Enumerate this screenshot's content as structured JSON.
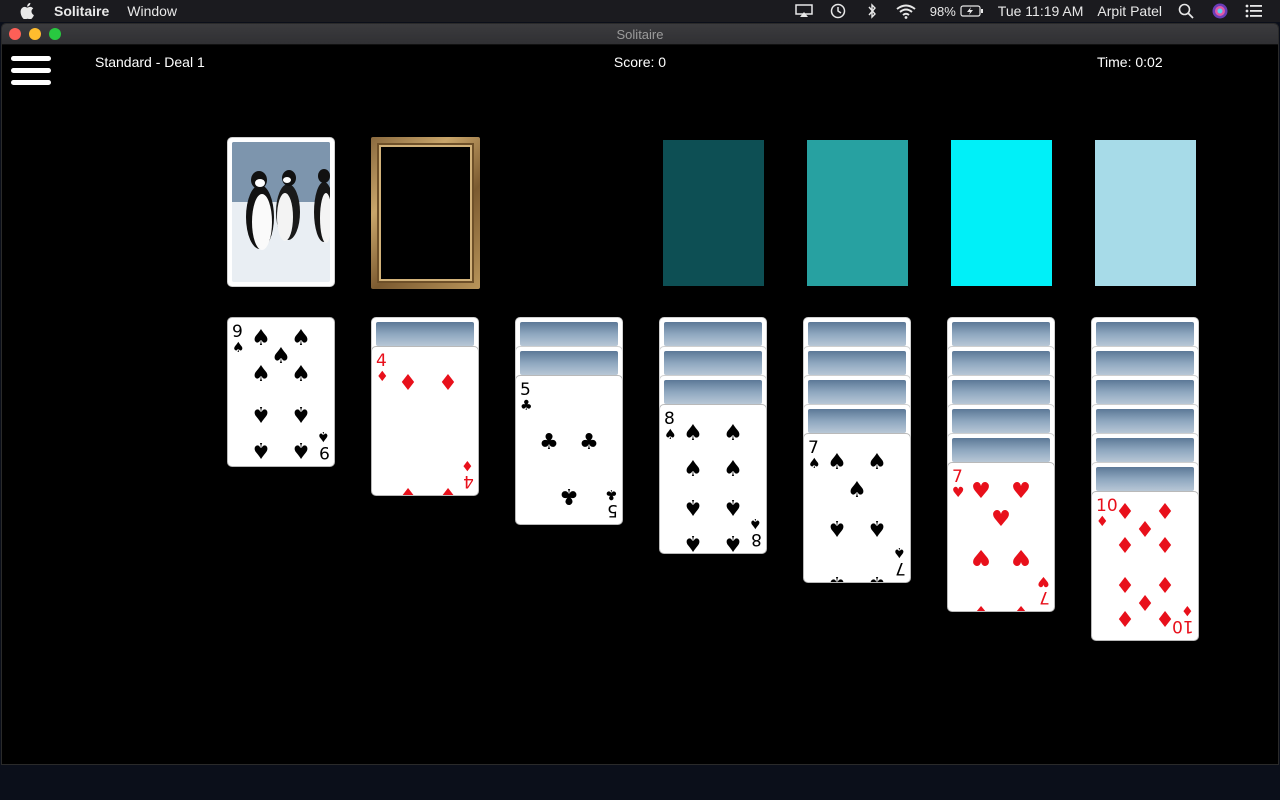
{
  "menubar": {
    "app_name": "Solitaire",
    "menu_window": "Window",
    "battery": "98%",
    "datetime": "Tue 11:19 AM",
    "user": "Arpit Patel",
    "icons": [
      "airplay-icon",
      "time-machine-icon",
      "bluetooth-icon",
      "wifi-icon",
      "battery-icon",
      "spotlight-icon",
      "siri-icon",
      "notification-center-icon"
    ]
  },
  "window": {
    "title": "Solitaire"
  },
  "game": {
    "deal_label": "Standard - Deal 1",
    "score_label": "Score: 0",
    "time_label": "Time: 0:02"
  },
  "foundations": [
    {
      "color": "#0d4f54"
    },
    {
      "color": "#27a1a1"
    },
    {
      "color": "#00f0f8"
    },
    {
      "color": "#a7dbe8"
    }
  ],
  "tableau": [
    {
      "face_down": 0,
      "card": {
        "rank": "9",
        "suit": "♠",
        "color": "black"
      }
    },
    {
      "face_down": 1,
      "card": {
        "rank": "4",
        "suit": "♦",
        "color": "red"
      }
    },
    {
      "face_down": 2,
      "card": {
        "rank": "5",
        "suit": "♣",
        "color": "black"
      }
    },
    {
      "face_down": 3,
      "card": {
        "rank": "8",
        "suit": "♠",
        "color": "black"
      }
    },
    {
      "face_down": 4,
      "card": {
        "rank": "7",
        "suit": "♠",
        "color": "black"
      }
    },
    {
      "face_down": 5,
      "card": {
        "rank": "7",
        "suit": "♥",
        "color": "red"
      }
    },
    {
      "face_down": 6,
      "card": {
        "rank": "10",
        "suit": "♦",
        "color": "red"
      }
    }
  ],
  "colors": {
    "background": "#000000",
    "card_face": "#ffffff",
    "red_suit": "#e8101b"
  }
}
